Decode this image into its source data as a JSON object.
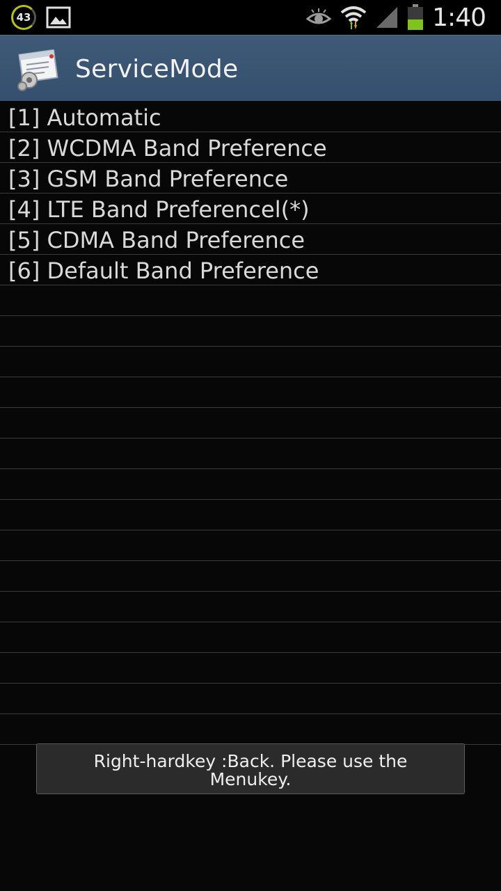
{
  "status_bar": {
    "badge_count": "43",
    "time": "1:40",
    "icons": [
      "notification-count-icon",
      "gallery-image-icon",
      "smart-stay-eye-icon",
      "wifi-icon",
      "cellular-signal-icon",
      "battery-icon"
    ],
    "colors": {
      "badge_ring": "#b8c400",
      "battery_fill": "#7fc31c"
    }
  },
  "action_bar": {
    "title": "ServiceMode",
    "icon": "service-mode-settings-icon",
    "color": "#3b5673"
  },
  "menu": {
    "items": [
      {
        "label": "[1] Automatic"
      },
      {
        "label": "[2] WCDMA Band Preference"
      },
      {
        "label": "[3] GSM Band Preference"
      },
      {
        "label": "[4] LTE Band Preferencel(*)"
      },
      {
        "label": "[5] CDMA Band Preference"
      },
      {
        "label": "[6] Default Band Preference"
      },
      {
        "label": ""
      },
      {
        "label": ""
      },
      {
        "label": ""
      },
      {
        "label": ""
      },
      {
        "label": ""
      },
      {
        "label": ""
      },
      {
        "label": ""
      },
      {
        "label": ""
      },
      {
        "label": ""
      },
      {
        "label": ""
      },
      {
        "label": ""
      },
      {
        "label": ""
      },
      {
        "label": ""
      },
      {
        "label": ""
      },
      {
        "label": ""
      }
    ]
  },
  "toast": {
    "message": "Right-hardkey :Back.   Please use the Menukey."
  }
}
